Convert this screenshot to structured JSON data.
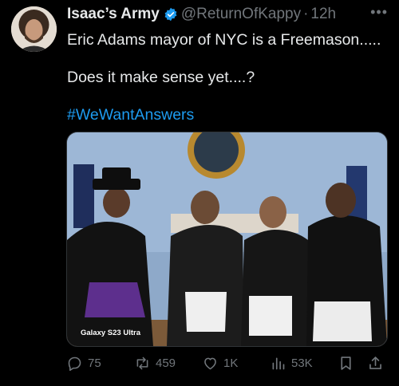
{
  "tweet": {
    "author_name": "Isaac’s Army",
    "author_handle": "@ReturnOfKappy",
    "separator": "·",
    "timestamp": "12h",
    "text_line1": "Eric Adams mayor of NYC is a Freemason.....",
    "text_line2": "Does it make sense yet....?",
    "hashtag": "#WeWantAnswers",
    "media": {
      "watermark": "Galaxy S23 Ultra"
    },
    "more_icon": "more-horizontal-icon",
    "verified_icon": "verified-badge-icon"
  },
  "actions": {
    "replies": "75",
    "retweets": "459",
    "likes": "1K",
    "views": "53K",
    "icons": [
      "reply-icon",
      "retweet-icon",
      "like-icon",
      "views-icon",
      "bookmark-icon",
      "share-icon"
    ]
  },
  "colors": {
    "background": "#000000",
    "text": "#e7e9ea",
    "muted": "#71767b",
    "accent": "#1d9bf0"
  }
}
